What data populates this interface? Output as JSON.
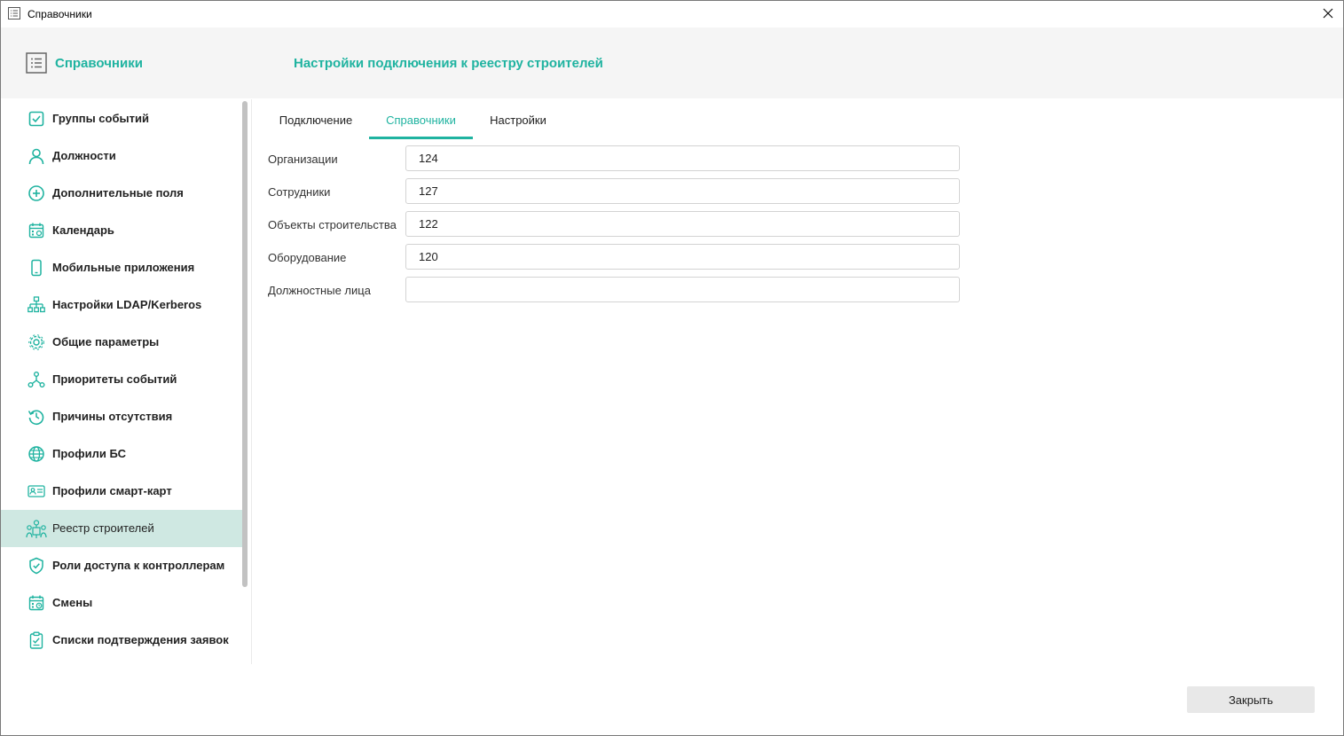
{
  "window": {
    "title": "Справочники"
  },
  "header": {
    "title": "Справочники",
    "subtitle": "Настройки подключения к реестру строителей"
  },
  "sidebar": {
    "items": [
      {
        "label": "Группы событий",
        "icon": "checkbox-icon"
      },
      {
        "label": "Должности",
        "icon": "user-icon"
      },
      {
        "label": "Дополнительные поля",
        "icon": "plus-circle-icon"
      },
      {
        "label": "Календарь",
        "icon": "calendar-icon"
      },
      {
        "label": "Мобильные приложения",
        "icon": "smartphone-icon"
      },
      {
        "label": "Настройки LDAP/Kerberos",
        "icon": "network-icon"
      },
      {
        "label": "Общие параметры",
        "icon": "gear-icon"
      },
      {
        "label": "Приоритеты событий",
        "icon": "nodes-icon"
      },
      {
        "label": "Причины отсутствия",
        "icon": "history-icon"
      },
      {
        "label": "Профили БС",
        "icon": "globe-icon"
      },
      {
        "label": "Профили смарт-карт",
        "icon": "id-card-icon"
      },
      {
        "label": "Реестр строителей",
        "icon": "builders-icon",
        "active": true
      },
      {
        "label": "Роли доступа к контроллерам",
        "icon": "shield-check-icon"
      },
      {
        "label": "Смены",
        "icon": "calendar-clock-icon"
      },
      {
        "label": "Списки подтверждения заявок",
        "icon": "clipboard-check-icon"
      }
    ]
  },
  "tabs": [
    {
      "label": "Подключение"
    },
    {
      "label": "Справочники",
      "active": true
    },
    {
      "label": "Настройки"
    }
  ],
  "form": {
    "fields": [
      {
        "label": "Организации",
        "value": "124"
      },
      {
        "label": "Сотрудники",
        "value": "127"
      },
      {
        "label": "Объекты строительства",
        "value": "122"
      },
      {
        "label": "Оборудование",
        "value": "120"
      },
      {
        "label": "Должностные лица",
        "value": ""
      }
    ]
  },
  "footer": {
    "close_label": "Закрыть"
  },
  "colors": {
    "accent": "#1fb3a0",
    "active_bg": "#cfe8e2",
    "header_bg": "#f5f5f5"
  }
}
